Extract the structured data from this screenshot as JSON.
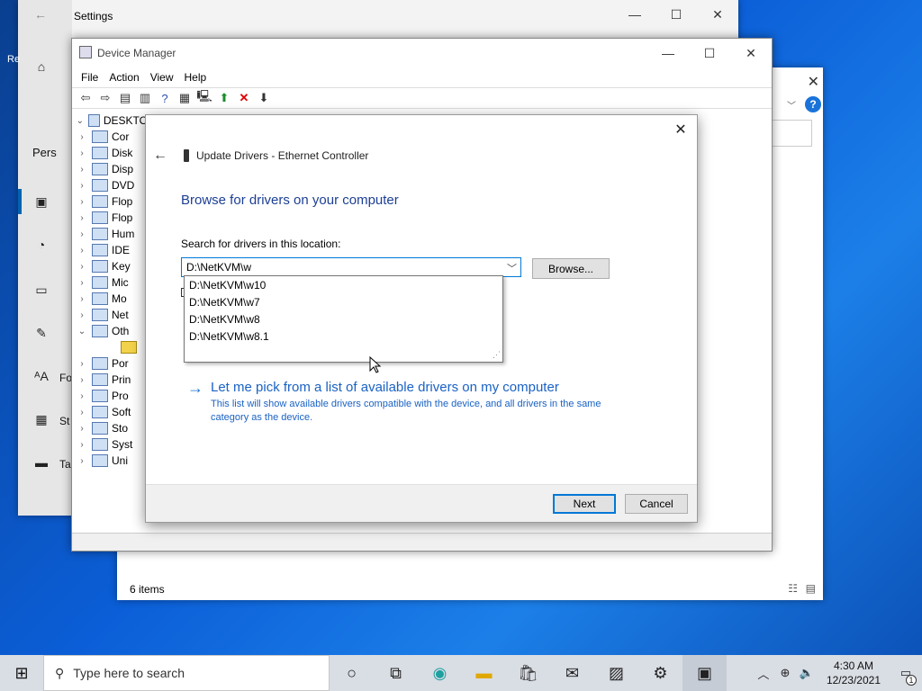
{
  "settings": {
    "title": "Settings",
    "sidebar_labels": [
      "Re",
      "Pers",
      "Fo",
      "St",
      "Ta"
    ]
  },
  "explorer": {
    "status": "6 items"
  },
  "devmgr": {
    "title": "Device Manager",
    "menus": [
      "File",
      "Action",
      "View",
      "Help"
    ],
    "root": "DESKTO",
    "tree": [
      "Cor",
      "Disk",
      "Disp",
      "DVD",
      "Flop",
      "Flop",
      "Hum",
      "IDE",
      "Key",
      "Mic",
      "Mo",
      "Net",
      "Oth",
      "",
      "Por",
      "Prin",
      "Pro",
      "Soft",
      "Sto",
      "Syst",
      "Uni"
    ]
  },
  "dialog": {
    "header": "Update Drivers - Ethernet Controller",
    "heading": "Browse for drivers on your computer",
    "search_label": "Search for drivers in this location:",
    "path_value": "D:\\NetKVM\\w",
    "browse_label": "Browse...",
    "suggestions": [
      "D:\\NetKVM\\w10",
      "D:\\NetKVM\\w7",
      "D:\\NetKVM\\w8",
      "D:\\NetKVM\\w8.1"
    ],
    "pick_title": "Let me pick from a list of available drivers on my computer",
    "pick_desc": "This list will show available drivers compatible with the device, and all drivers in the same category as the device.",
    "next_label": "Next",
    "cancel_label": "Cancel"
  },
  "taskbar": {
    "search_placeholder": "Type here to search",
    "time": "4:30 AM",
    "date": "12/23/2021",
    "notification_count": "1"
  }
}
